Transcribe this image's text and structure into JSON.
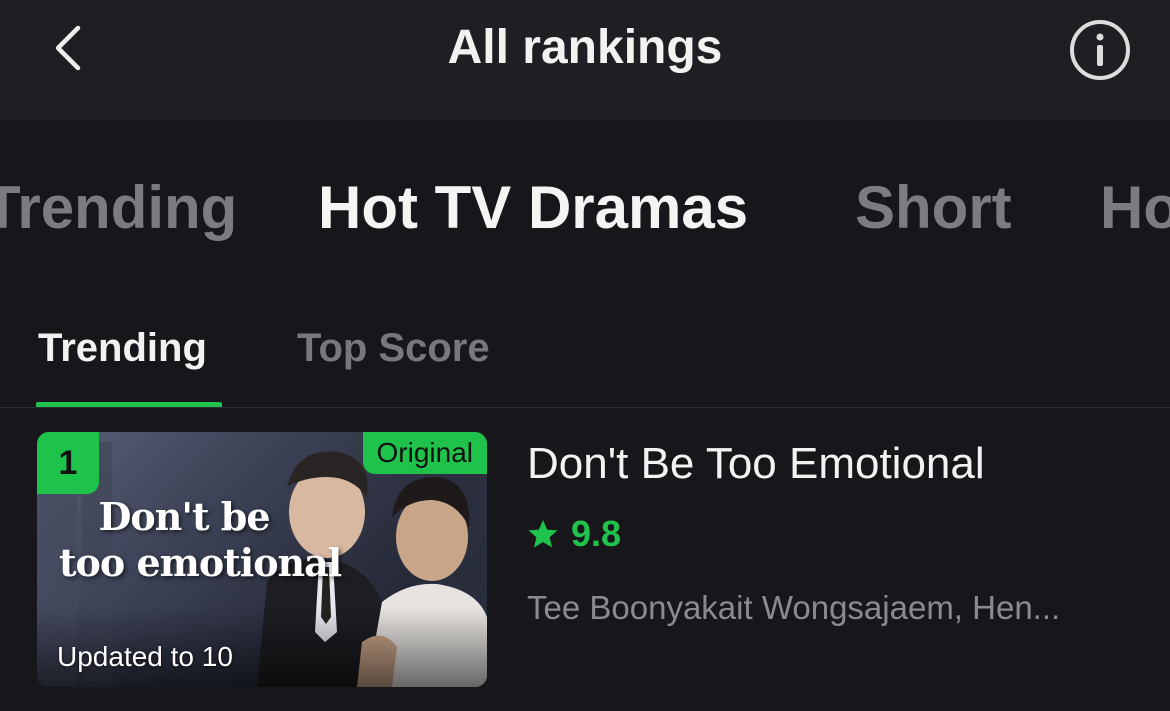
{
  "header": {
    "title": "All rankings",
    "back_icon": "chevron-left-icon",
    "info_icon": "info-icon"
  },
  "category_tabs": [
    {
      "label": "Trending",
      "active": false
    },
    {
      "label": "Hot TV Dramas",
      "active": true
    },
    {
      "label": "Short",
      "active": false
    },
    {
      "label": "Ho",
      "active": false
    }
  ],
  "sub_tabs": [
    {
      "label": "Trending",
      "active": true
    },
    {
      "label": "Top Score",
      "active": false
    }
  ],
  "items": [
    {
      "rank": "1",
      "badge": "Original",
      "poster_text": [
        "Don't be",
        "too emotional"
      ],
      "update_status": "Updated to 10",
      "title": "Don't Be Too Emotional",
      "rating": "9.8",
      "cast": "Tee Boonyakait Wongsajaem, Hen..."
    }
  ],
  "colors": {
    "accent": "#1fc24a",
    "background": "#17171b",
    "header_background": "#1e1f23",
    "inactive_text": "#7b7c81"
  }
}
